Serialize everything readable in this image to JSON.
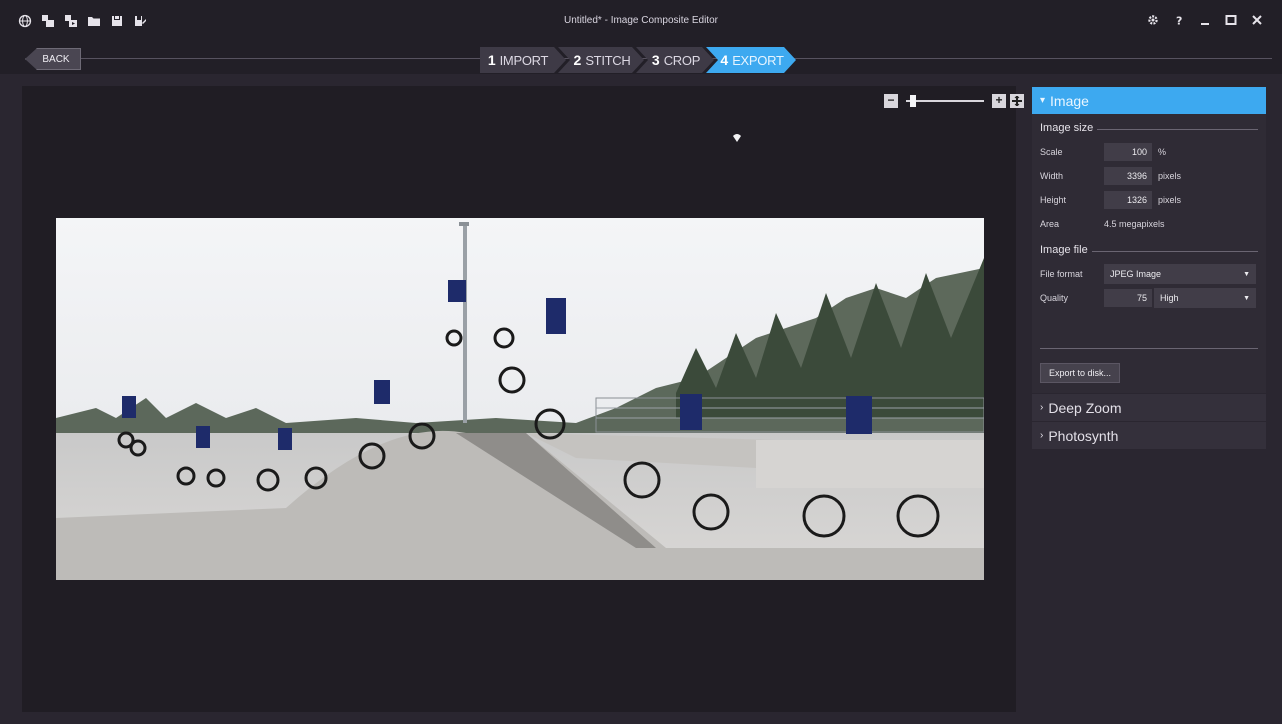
{
  "window": {
    "title": "Untitled* - Image Composite Editor"
  },
  "toolbar": {
    "icons": [
      "globe-icon",
      "new-panorama-icon",
      "new-panorama-video-icon",
      "open-folder-icon",
      "save-icon",
      "save-as-icon"
    ]
  },
  "nav": {
    "back_label": "BACK",
    "steps": [
      {
        "num": "1",
        "label": "IMPORT"
      },
      {
        "num": "2",
        "label": "STITCH"
      },
      {
        "num": "3",
        "label": "CROP"
      },
      {
        "num": "4",
        "label": "EXPORT"
      }
    ],
    "active_step": 4
  },
  "zoom": {
    "minus": "−",
    "plus": "+",
    "level_fraction": 0.05
  },
  "panel": {
    "image_header": "Image",
    "image_size_title": "Image size",
    "scale_label": "Scale",
    "scale_value": "100",
    "scale_unit": "%",
    "width_label": "Width",
    "width_value": "3396",
    "width_unit": "pixels",
    "height_label": "Height",
    "height_value": "1326",
    "height_unit": "pixels",
    "area_label": "Area",
    "area_value": "4.5 megapixels",
    "image_file_title": "Image file",
    "file_format_label": "File format",
    "file_format_value": "JPEG Image",
    "quality_label": "Quality",
    "quality_value": "75",
    "quality_preset": "High",
    "export_button": "Export to disk...",
    "deep_zoom_header": "Deep Zoom",
    "photosynth_header": "Photosynth"
  },
  "colors": {
    "accent": "#3da9f0",
    "background": "#2a2630",
    "panel": "#2f2b35"
  }
}
